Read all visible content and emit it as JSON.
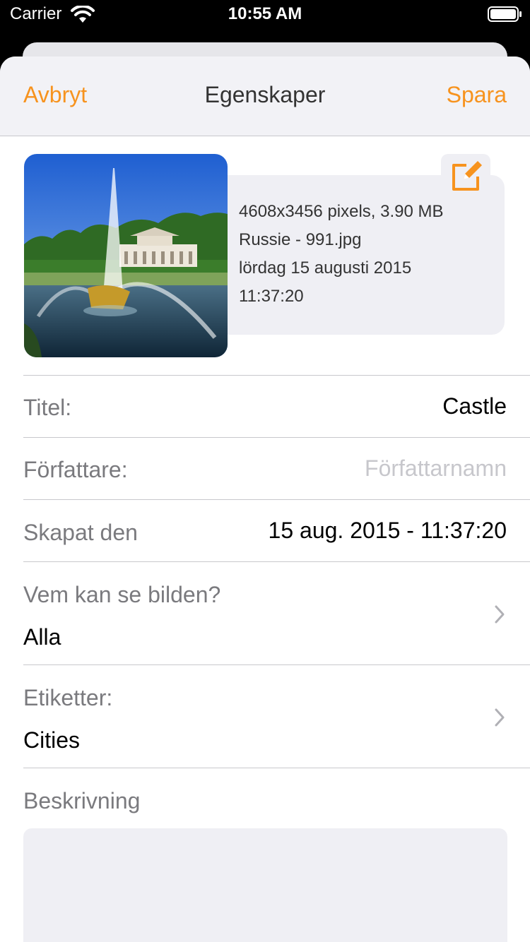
{
  "status_bar": {
    "carrier": "Carrier",
    "time": "10:55 AM"
  },
  "navbar": {
    "cancel": "Avbryt",
    "title": "Egenskaper",
    "save": "Spara"
  },
  "image_info": {
    "dimensions": "4608x3456 pixels, 3.90 MB",
    "filename": "Russie - 991.jpg",
    "date": "lördag 15 augusti 2015",
    "time": "11:37:20"
  },
  "fields": {
    "title": {
      "label": "Titel:",
      "value": "Castle"
    },
    "author": {
      "label": "Författare:",
      "placeholder": "Författarnamn"
    },
    "created": {
      "label": "Skapat den",
      "value": "15 aug. 2015 - 11:37:20"
    },
    "privacy": {
      "label": "Vem kan se bilden?",
      "value": "Alla"
    },
    "tags": {
      "label": "Etiketter:",
      "value": "Cities"
    },
    "description": {
      "label": "Beskrivning",
      "value": ""
    }
  },
  "colors": {
    "accent": "#f7931e",
    "label": "#7a7a7e",
    "separator": "#c8c8cc",
    "card": "#efeff4"
  },
  "icons": {
    "edit": "edit-icon",
    "chevron": "chevron-right-icon",
    "wifi": "wifi-icon",
    "battery": "battery-icon"
  }
}
